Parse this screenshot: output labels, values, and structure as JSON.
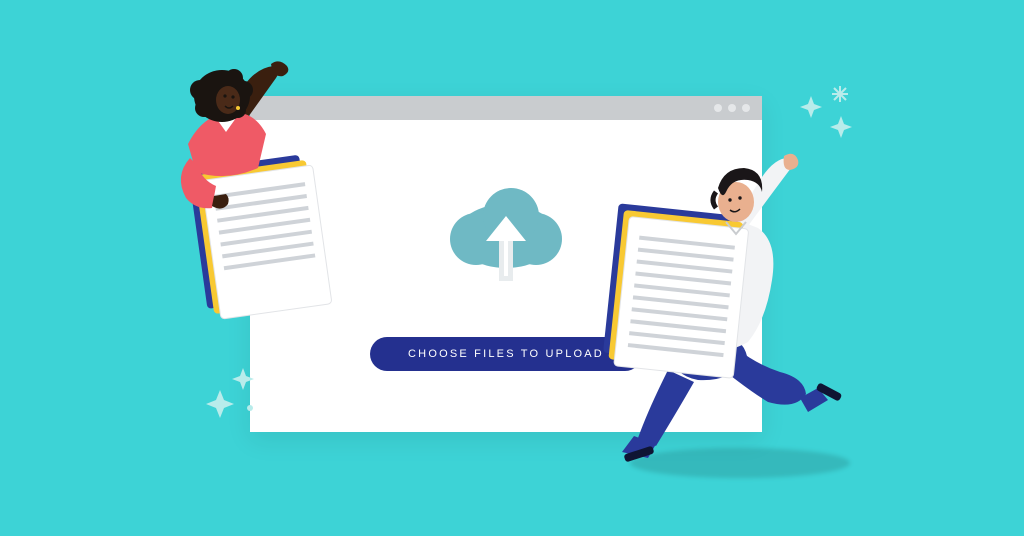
{
  "upload": {
    "button_label": "CHOOSE FILES TO UPLOAD"
  },
  "colors": {
    "bg": "#3dd3d6",
    "button": "#24308f",
    "cloud": "#6fb9c4",
    "accent_yellow": "#f8c933",
    "accent_blue": "#2a3a9b"
  }
}
